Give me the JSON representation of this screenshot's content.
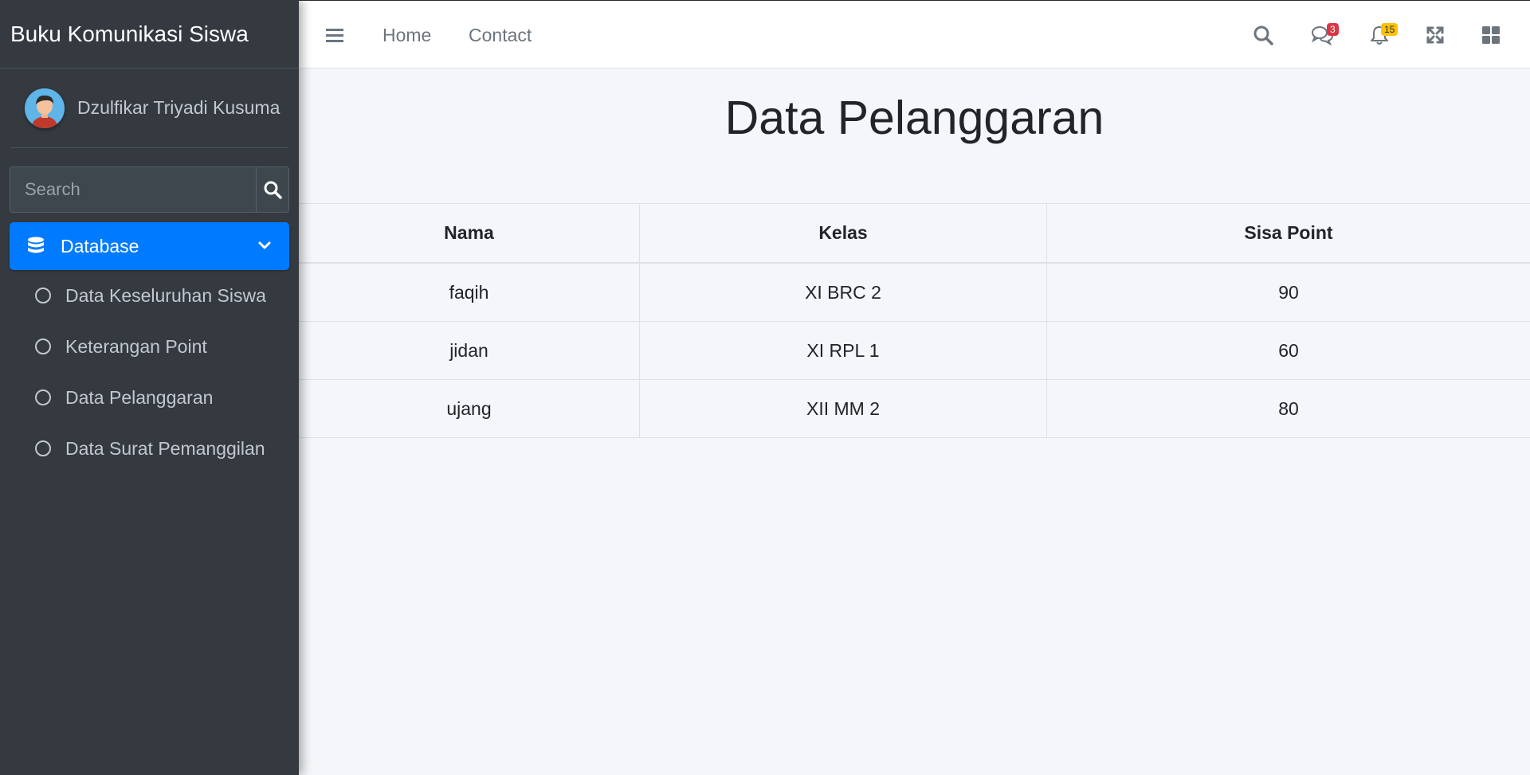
{
  "sidebar": {
    "brand": "Buku Komunikasi Siswa",
    "user_name": "Dzulfikar Triyadi Kusuma",
    "search_placeholder": "Search",
    "menu_main": "Database",
    "menu_items": [
      {
        "label": "Data Keseluruhan Siswa"
      },
      {
        "label": "Keterangan Point"
      },
      {
        "label": "Data Pelanggaran"
      },
      {
        "label": "Data Surat Pemanggilan"
      }
    ]
  },
  "navbar": {
    "links": [
      "Home",
      "Contact"
    ],
    "messages_badge": "3",
    "notifications_badge": "15"
  },
  "main": {
    "title": "Data Pelanggaran",
    "table": {
      "headers": [
        "Nama",
        "Kelas",
        "Sisa Point"
      ],
      "rows": [
        [
          "faqih",
          "XI BRC 2",
          "90"
        ],
        [
          "jidan",
          "XI RPL 1",
          "60"
        ],
        [
          "ujang",
          "XII MM 2",
          "80"
        ]
      ]
    }
  },
  "colors": {
    "sidebar_bg": "#343a40",
    "accent": "#007bff",
    "badge_danger": "#dc3545",
    "badge_warning": "#ffc107"
  }
}
